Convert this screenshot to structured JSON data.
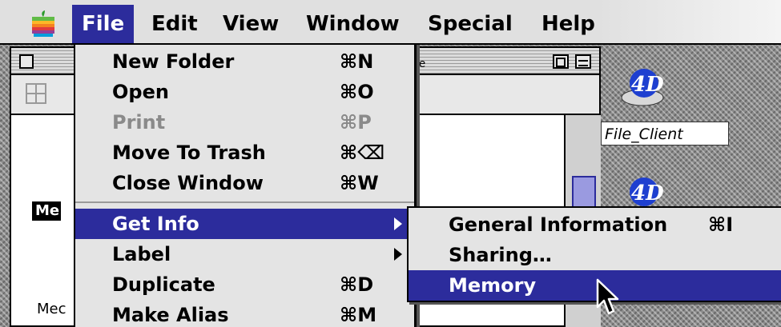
{
  "menubar": {
    "apple_icon": "apple-logo",
    "menus": [
      {
        "label": "File",
        "active": true
      },
      {
        "label": "Edit"
      },
      {
        "label": "View"
      },
      {
        "label": "Window"
      },
      {
        "label": "Special"
      },
      {
        "label": "Help"
      }
    ]
  },
  "file_menu": {
    "items": [
      {
        "label": "New Folder",
        "shortcut": "⌘N"
      },
      {
        "label": "Open",
        "shortcut": "⌘O"
      },
      {
        "label": "Print",
        "shortcut": "⌘P",
        "disabled": true
      },
      {
        "label": "Move To Trash",
        "shortcut": "⌘⌫"
      },
      {
        "label": "Close Window",
        "shortcut": "⌘W"
      },
      {
        "label": "Get Info",
        "submenu": true,
        "highlighted": true
      },
      {
        "label": "Label",
        "submenu": true
      },
      {
        "label": "Duplicate",
        "shortcut": "⌘D"
      },
      {
        "label": "Make Alias",
        "shortcut": "⌘M"
      }
    ]
  },
  "get_info_submenu": {
    "items": [
      {
        "label": "General Information",
        "shortcut": "⌘I"
      },
      {
        "label": "Sharing…"
      },
      {
        "label": "Memory",
        "highlighted": true
      }
    ]
  },
  "finder_window": {
    "column_header_fragment": "ble",
    "selected_item_fragment": "Me",
    "bottom_item_fragment": "Mec"
  },
  "desktop": {
    "icons": [
      {
        "label": "4DFile_Client",
        "icon": "4d-app-icon"
      },
      {
        "label": "",
        "icon": "4d-app-icon"
      }
    ],
    "icon_label_visible": "File_Client"
  },
  "colors": {
    "highlight": "#2c2c9c",
    "menu_bg": "#e4e4e4",
    "disabled_text": "#8a8a8a"
  }
}
